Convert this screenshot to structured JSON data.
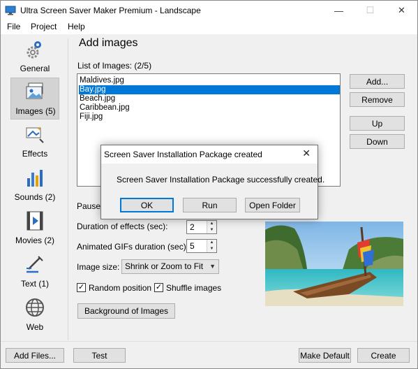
{
  "window": {
    "title": "Ultra Screen Saver Maker Premium - Landscape",
    "minimize": "—",
    "maximize": "☐",
    "close": "✕"
  },
  "menu": [
    "File",
    "Project",
    "Help"
  ],
  "sidebar": {
    "items": [
      {
        "label": "General",
        "icon": "gear-icon"
      },
      {
        "label": "Images (5)",
        "icon": "images-icon"
      },
      {
        "label": "Effects",
        "icon": "effects-icon"
      },
      {
        "label": "Sounds (2)",
        "icon": "sounds-icon"
      },
      {
        "label": "Movies (2)",
        "icon": "movies-icon"
      },
      {
        "label": "Text (1)",
        "icon": "text-icon"
      },
      {
        "label": "Web",
        "icon": "web-icon"
      }
    ]
  },
  "main": {
    "heading": "Add images",
    "list_label": "List of Images:",
    "list_count": "(2/5)",
    "images": [
      "Maldives.jpg",
      "Bay.jpg",
      "Beach.jpg",
      "Caribbean.jpg",
      "Fiji.jpg"
    ],
    "selected_index": 1,
    "buttons": {
      "add": "Add...",
      "remove": "Remove",
      "up": "Up",
      "down": "Down"
    },
    "pause_label": "Pause a",
    "duration_effects_label": "Duration of effects (sec):",
    "duration_effects_value": "2",
    "animated_gifs_label": "Animated GIFs duration (sec):",
    "animated_gifs_value": "5",
    "image_size_label": "Image size:",
    "image_size_value": "Shrink or Zoom to Fit",
    "random_position_label": "Random position",
    "random_position_checked": true,
    "shuffle_images_label": "Shuffle images",
    "shuffle_images_checked": true,
    "background_button": "Background of Images"
  },
  "footer": {
    "add_files": "Add Files...",
    "test": "Test",
    "make_default": "Make Default",
    "create": "Create"
  },
  "dialog": {
    "title": "Screen Saver Installation Package created",
    "message": "Screen Saver Installation Package successfully created.",
    "ok": "OK",
    "run": "Run",
    "open_folder": "Open Folder"
  },
  "colors": {
    "accent": "#0078d7",
    "selection": "#0078d7"
  }
}
